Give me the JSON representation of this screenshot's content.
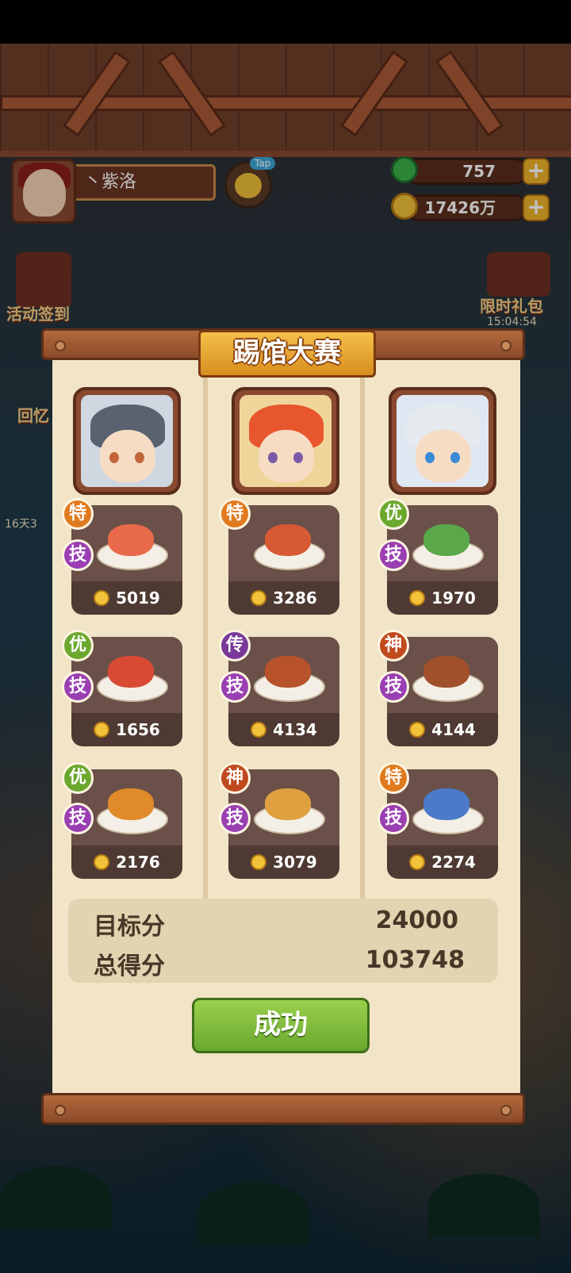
{
  "player": {
    "name": "丶紫洛",
    "tap_label": "Tap"
  },
  "currency": {
    "jade": "757",
    "coins": "17426万"
  },
  "side_events": {
    "checkin": "活动签到",
    "limited_gift": "限时礼包",
    "timer": "15:04:54",
    "memory": "回忆",
    "days": "16天3"
  },
  "modal": {
    "title": "踢馆大赛",
    "columns": [
      {
        "dishes": [
          {
            "grade": "特",
            "grade_color": "#e07a1e",
            "skill": "技",
            "price": "5019",
            "food_color": "#e86a4a"
          },
          {
            "grade": "优",
            "grade_color": "#6aa82e",
            "skill": "技",
            "price": "1656",
            "food_color": "#d84a34"
          },
          {
            "grade": "优",
            "grade_color": "#6aa82e",
            "skill": "技",
            "price": "2176",
            "food_color": "#e08a2a"
          }
        ]
      },
      {
        "dishes": [
          {
            "grade": "特",
            "grade_color": "#e07a1e",
            "skill": "技",
            "price": "3286",
            "food_color": "#d85a34"
          },
          {
            "grade": "传",
            "grade_color": "#7a3a9a",
            "skill": "技",
            "price": "4134",
            "food_color": "#b8522a"
          },
          {
            "grade": "神",
            "grade_color": "#c04a1e",
            "skill": "技",
            "price": "3079",
            "food_color": "#e0a040"
          }
        ]
      },
      {
        "dishes": [
          {
            "grade": "优",
            "grade_color": "#6aa82e",
            "skill": "技",
            "price": "1970",
            "food_color": "#5aa84a"
          },
          {
            "grade": "神",
            "grade_color": "#c04a1e",
            "skill": "技",
            "price": "4144",
            "food_color": "#a0502a"
          },
          {
            "grade": "特",
            "grade_color": "#e07a1e",
            "skill": "技",
            "price": "2274",
            "food_color": "#4a7ac8"
          }
        ]
      }
    ],
    "target_label": "目标分",
    "target_value": "24000",
    "total_label": "总得分",
    "total_value": "103748",
    "result_button": "成功"
  }
}
